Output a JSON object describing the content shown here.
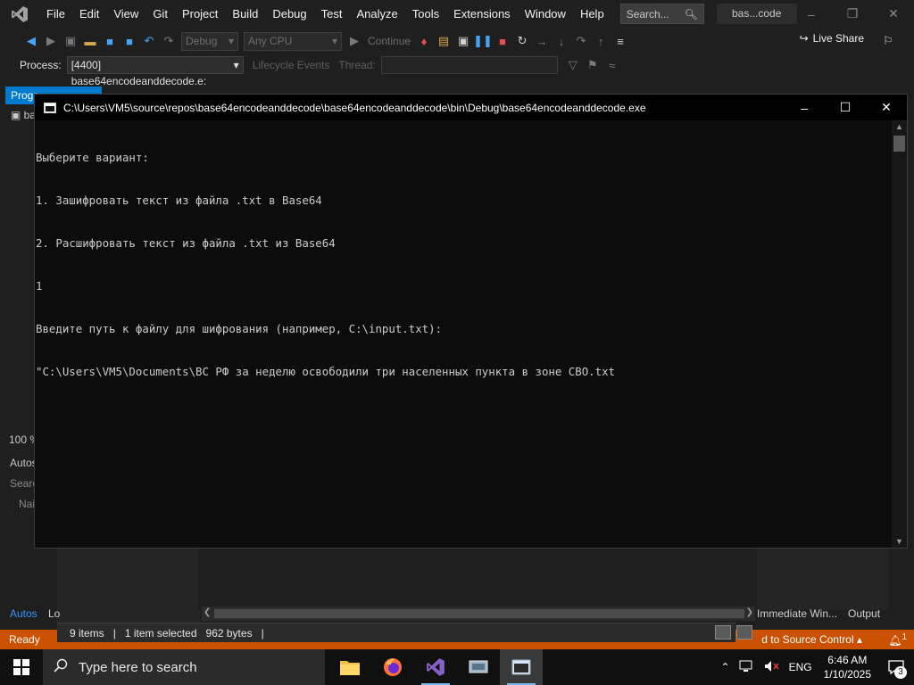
{
  "menubar": {
    "items": [
      "File",
      "Edit",
      "View",
      "Git",
      "Project",
      "Build",
      "Debug",
      "Test",
      "Analyze",
      "Tools",
      "Extensions",
      "Window",
      "Help"
    ],
    "search_placeholder": "Search...",
    "solution_name": "bas...code"
  },
  "toolbar": {
    "config": "Debug",
    "platform": "Any CPU",
    "continue_label": "Continue",
    "live_share": "Live Share"
  },
  "debug_toolbar": {
    "process_label": "Process:",
    "process_value": "[4400] base64encodeanddecode.e:",
    "lifecycle_label": "Lifecycle Events",
    "thread_label": "Thread:"
  },
  "left_panel": {
    "tab_label": "Progr",
    "item_label": "bas",
    "zoom": "100 %",
    "autos_header": "Autos",
    "search_label": "Searc",
    "name_col": "Nai"
  },
  "bottom_tabs": {
    "autos": "Autos",
    "locals": "Lo",
    "immediate": "Immediate Win...",
    "output": "Output"
  },
  "explorer_status": {
    "items": "9 items",
    "selected": "1 item selected",
    "size": "962 bytes"
  },
  "statusbar": {
    "ready": "Ready",
    "source_control": "d to Source Control",
    "notifications": "1"
  },
  "console": {
    "title": "C:\\Users\\VM5\\source\\repos\\base64encodeanddecode\\base64encodeanddecode\\bin\\Debug\\base64encodeanddecode.exe",
    "lines": [
      "Выберите вариант:",
      "1. Зашифровать текст из файла .txt в Base64",
      "2. Расшифровать текст из файла .txt из Base64",
      "1",
      "Введите путь к файлу для шифрования (например, C:\\input.txt):",
      "\"C:\\Users\\VM5\\Documents\\ВС РФ за неделю освободили три населенных пункта в зоне СВО.txt"
    ]
  },
  "taskbar": {
    "search_placeholder": "Type here to search",
    "language": "ENG",
    "time": "6:46 AM",
    "date": "1/10/2025",
    "notification_count": "3"
  },
  "colors": {
    "accent": "#007acc",
    "status_bar": "#ca5100",
    "vs_purple": "#8661c5",
    "console_bg": "#0c0c0c"
  }
}
